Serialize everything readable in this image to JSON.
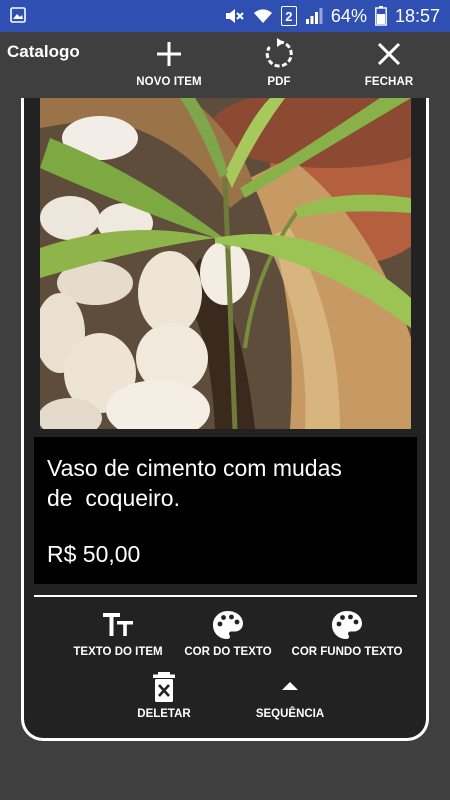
{
  "status": {
    "battery_percent": "64%",
    "time": "18:57",
    "sim_slot": "2"
  },
  "actionbar": {
    "title": "Catalogo",
    "novo_item": "NOVO ITEM",
    "pdf": "PDF",
    "fechar": "FECHAR"
  },
  "item": {
    "description": "Vaso de cimento com mudas\nde  coqueiro.",
    "price": "R$ 50,00"
  },
  "tools": {
    "texto_do_item": "TEXTO DO ITEM",
    "cor_do_texto": "COR DO TEXTO",
    "cor_fundo_texto": "COR FUNDO TEXTO",
    "deletar": "DELETAR",
    "sequencia": "SEQUÊNCIA"
  },
  "icons": {
    "gallery": "image-icon",
    "mute": "volume-mute-icon",
    "wifi": "wifi-icon",
    "signal": "signal-icon",
    "battery": "battery-icon",
    "add": "plus-icon",
    "pdf": "refresh-icon",
    "close": "close-icon",
    "text_size": "text-size-icon",
    "palette": "palette-icon",
    "delete": "delete-icon",
    "sequence": "arrow-up-icon"
  },
  "colors": {
    "status_bar": "#2f4fb3",
    "app_background": "#3f3f3f",
    "card_background": "#222222",
    "text_box": "#000000"
  }
}
